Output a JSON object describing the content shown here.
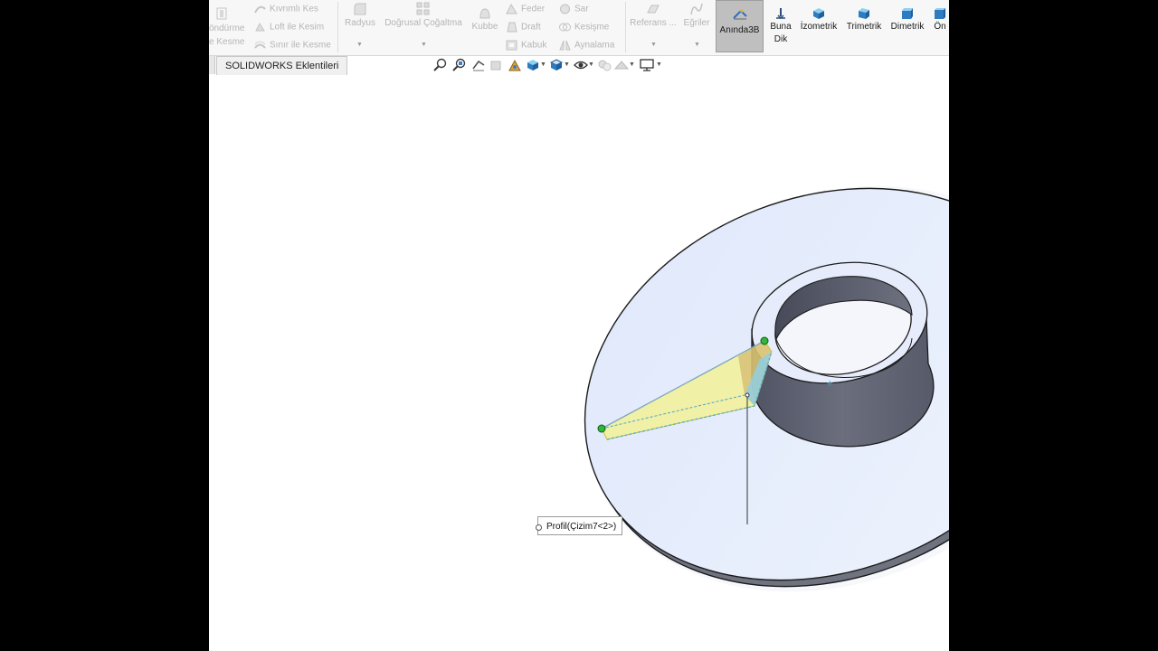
{
  "ribbon": {
    "left_group": {
      "dondurme": "öndürme",
      "kesme": "e Kesme",
      "kivrimli_kes": "Kıvrımlı Kes",
      "loft_ile_kesim": "Loft ile Kesim",
      "sinir_ile_kesme": "Sınır ile Kesme"
    },
    "features": {
      "radyus": "Radyus",
      "dogrusal_cogaltma": "Doğrusal Çoğaltma",
      "kubbe": "Kubbe",
      "feder": "Feder",
      "draft": "Draft",
      "kabuk": "Kabuk",
      "sar": "Sar",
      "kesisme": "Kesişme",
      "aynalama": "Aynalama"
    },
    "reference": {
      "referans": "Referans ...",
      "egriler": "Eğriler"
    },
    "instant3d": {
      "label": "Anında3B",
      "active": true
    },
    "views": [
      {
        "label": "Buna Dik",
        "icon": "normal-to-icon"
      },
      {
        "label": "İzometrik",
        "icon": "isometric-cube-icon"
      },
      {
        "label": "Trimetrik",
        "icon": "trimetric-cube-icon"
      },
      {
        "label": "Dimetrik",
        "icon": "dimetric-cube-icon"
      },
      {
        "label": "Ön",
        "icon": "front-view-icon"
      }
    ]
  },
  "tabs": {
    "active": "SOLIDWORKS Eklentileri"
  },
  "headsup_toolbar": [
    "zoom-to-fit-icon",
    "zoom-area-icon",
    "previous-view-icon",
    "section-view-icon",
    "dynamic-annotation-icon",
    "view-orientation-icon",
    "display-style-icon",
    "hide-show-icon",
    "edit-appearance-icon",
    "apply-scene-icon",
    "view-settings-icon"
  ],
  "viewport": {
    "callout_text": "Profil(Çizim7<2>)",
    "colors": {
      "face": "#e4ecfb",
      "edge": "#1b1b1b",
      "side": "#6f7380",
      "boss": "#5f6372",
      "preview_fill": "#f4f28a",
      "preview_edge": "#4fa8c8",
      "point": "#1f9a2a"
    }
  }
}
